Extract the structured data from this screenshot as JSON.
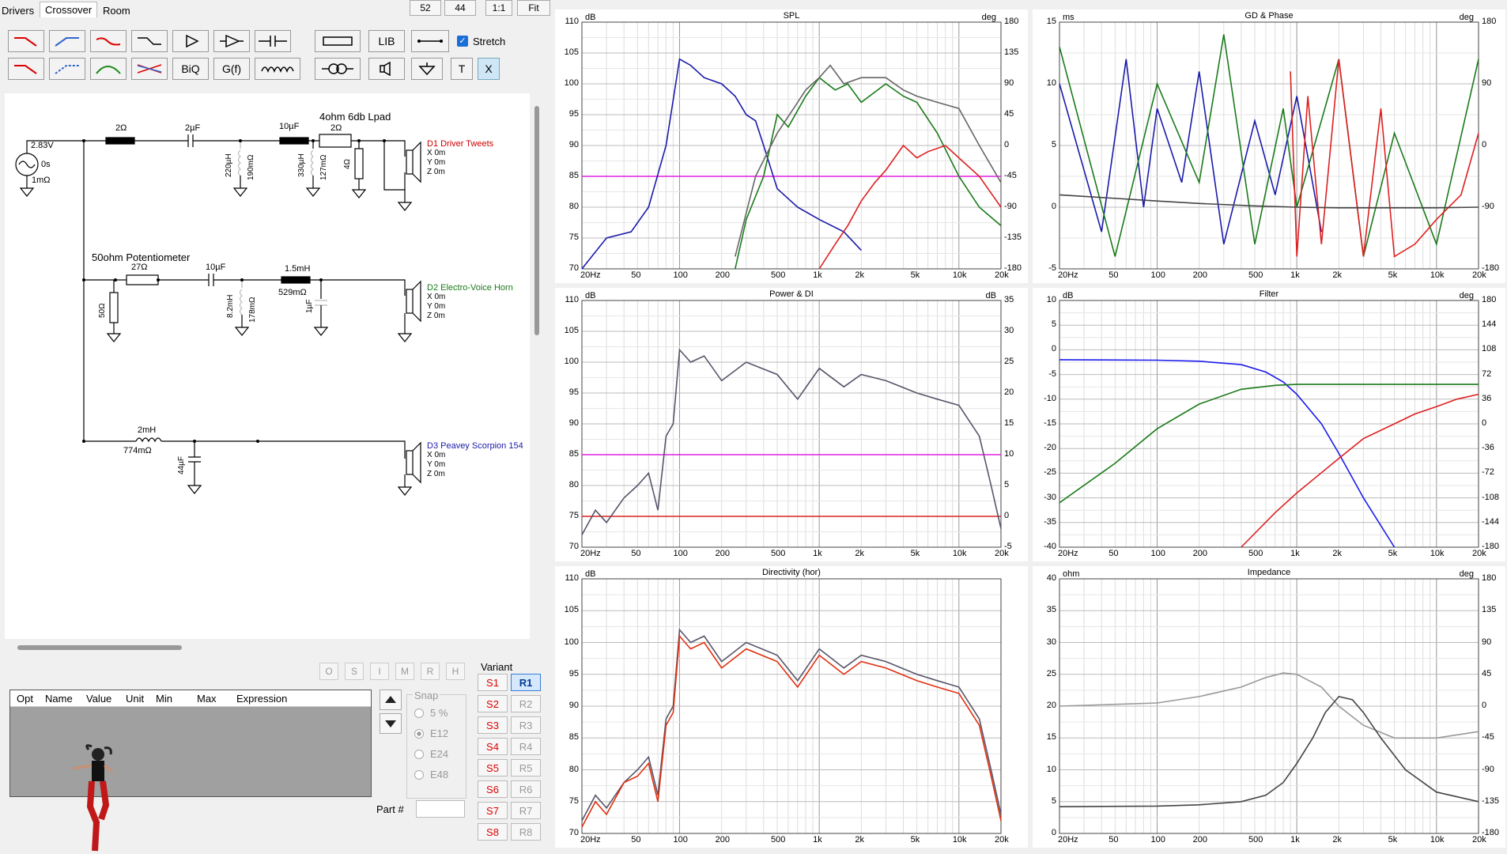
{
  "tabs": [
    {
      "label": "Drivers"
    },
    {
      "label": "Crossover"
    },
    {
      "label": "Room"
    }
  ],
  "top_buttons": [
    {
      "label": "52"
    },
    {
      "label": "44"
    },
    {
      "label": "1:1"
    },
    {
      "label": "Fit"
    }
  ],
  "toolbar": {
    "lib_label": "LIB",
    "biq_label": "BiQ",
    "gf_label": "G(f)",
    "t_label": "T",
    "x_label": "X",
    "stretch_label": "Stretch",
    "stretch_checked": true
  },
  "schematic": {
    "source": {
      "voltage": "2.83V",
      "delay": "0s",
      "resistance": "1mΩ"
    },
    "branch1": {
      "r1": "2Ω",
      "c1": "2µF",
      "l1": "220µH",
      "l1r": "190mΩ",
      "c2": "10µF",
      "l2": "330µH",
      "l2r": "127mΩ",
      "r2": "2Ω",
      "r3": "4Ω",
      "note": "4ohm 6db Lpad"
    },
    "branch2": {
      "note": "50ohm Potentiometer",
      "r1": "27Ω",
      "r2": "50Ω",
      "c1": "10µF",
      "l1": "8.2mH",
      "l1r": "178mΩ",
      "l2": "1.5mH",
      "l2r": "529mΩ",
      "c2": "1µF"
    },
    "branch3": {
      "l1": "2mH",
      "l1r": "774mΩ",
      "c1": "44µF"
    },
    "drivers": [
      {
        "name": "D1 Driver Tweets",
        "x": "X 0m",
        "y": "Y 0m",
        "z": "Z 0m",
        "color": "#cc0000"
      },
      {
        "name": "D2 Electro-Voice Horn",
        "x": "X 0m",
        "y": "Y 0m",
        "z": "Z 0m",
        "color": "#1a7a1a"
      },
      {
        "name": "D3 Peavey Scorpion 154",
        "x": "X 0m",
        "y": "Y 0m",
        "z": "Z 0m",
        "color": "#1a1aaa"
      }
    ]
  },
  "filter_buttons": [
    {
      "label": "O"
    },
    {
      "label": "S"
    },
    {
      "label": "I"
    },
    {
      "label": "M"
    },
    {
      "label": "R"
    },
    {
      "label": "H"
    }
  ],
  "param_table": {
    "columns": [
      "Opt",
      "Name",
      "Value",
      "Unit",
      "Min",
      "Max",
      "Expression"
    ]
  },
  "snap": {
    "label": "Snap",
    "options": [
      {
        "label": "5 %"
      },
      {
        "label": "E12"
      },
      {
        "label": "E24"
      },
      {
        "label": "E48"
      }
    ],
    "selected": 1
  },
  "part_label": "Part #",
  "variant": {
    "label": "Variant",
    "s": [
      {
        "label": "S1"
      },
      {
        "label": "S2"
      },
      {
        "label": "S3"
      },
      {
        "label": "S4"
      },
      {
        "label": "S5"
      },
      {
        "label": "S6"
      },
      {
        "label": "S7"
      },
      {
        "label": "S8"
      }
    ],
    "r": [
      {
        "label": "R1"
      },
      {
        "label": "R2"
      },
      {
        "label": "R3"
      },
      {
        "label": "R4"
      },
      {
        "label": "R5"
      },
      {
        "label": "R6"
      },
      {
        "label": "R7"
      },
      {
        "label": "R8"
      }
    ],
    "selected_r": "R1"
  },
  "freq_ticks": [
    "20Hz",
    "50",
    "100",
    "200",
    "500",
    "1k",
    "2k",
    "5k",
    "10k",
    "20k"
  ],
  "chart_data": [
    {
      "type": "line",
      "title": "SPL",
      "ylabel": "dB",
      "y2label": "deg",
      "yticks": [
        "110",
        "105",
        "100",
        "95",
        "90",
        "85",
        "80",
        "75",
        "70"
      ],
      "y2ticks": [
        "180",
        "135",
        "90",
        "45",
        "0",
        "-45",
        "-90",
        "-135",
        "-180"
      ],
      "xlim": [
        20,
        20000
      ],
      "ylim": [
        70,
        110
      ],
      "xscale": "log",
      "reference_line": {
        "y": 85,
        "color": "#e020e0"
      },
      "series": [
        {
          "color": "#1a1aaa",
          "x": [
            20,
            30,
            45,
            60,
            80,
            100,
            120,
            150,
            200,
            250,
            300,
            350,
            400,
            500,
            700,
            1000,
            1500,
            2000
          ],
          "y": [
            70,
            75,
            76,
            80,
            90,
            104,
            103,
            101,
            100,
            98,
            95,
            94,
            90,
            83,
            80,
            78,
            76,
            73
          ]
        },
        {
          "color": "#1a7a1a",
          "x": [
            250,
            300,
            400,
            500,
            600,
            800,
            1000,
            1300,
            1600,
            2000,
            3000,
            4000,
            5000,
            7000,
            10000,
            14000,
            20000
          ],
          "y": [
            70,
            78,
            85,
            95,
            93,
            98,
            101,
            99,
            100,
            97,
            100,
            98,
            97,
            92,
            85,
            80,
            77
          ]
        },
        {
          "color": "#dd2020",
          "x": [
            1000,
            1300,
            1600,
            2000,
            2500,
            3000,
            4000,
            5000,
            6000,
            8000,
            10000,
            14000,
            20000
          ],
          "y": [
            70,
            74,
            77,
            81,
            84,
            86,
            90,
            88,
            89,
            90,
            88,
            85,
            80
          ]
        },
        {
          "color": "#666666",
          "x": [
            250,
            350,
            500,
            700,
            800,
            1000,
            1200,
            1500,
            2000,
            3000,
            4000,
            5000,
            7000,
            10000,
            14000,
            20000
          ],
          "y": [
            72,
            85,
            92,
            97,
            99,
            101,
            103,
            100,
            101,
            101,
            99,
            98,
            97,
            96,
            90,
            84
          ]
        }
      ]
    },
    {
      "type": "line",
      "title": "GD & Phase",
      "ylabel": "ms",
      "y2label": "deg",
      "yticks": [
        "15",
        "10",
        "5",
        "0",
        "-5"
      ],
      "y2ticks": [
        "180",
        "90",
        "0",
        "-90",
        "-180"
      ],
      "xlim": [
        20,
        20000
      ],
      "ylim": [
        -5,
        15
      ],
      "xscale": "log",
      "series": [
        {
          "color": "#1a1aaa",
          "x": [
            20,
            40,
            60,
            80,
            100,
            150,
            200,
            300,
            500,
            700,
            1000,
            1500
          ],
          "y": [
            10,
            -2,
            12,
            0,
            8,
            2,
            11,
            -3,
            7,
            1,
            9,
            -2
          ]
        },
        {
          "color": "#1a7a1a",
          "x": [
            20,
            50,
            100,
            200,
            300,
            500,
            800,
            1000,
            2000,
            3000,
            5000,
            10000,
            20000
          ],
          "y": [
            13,
            -4,
            10,
            2,
            14,
            -3,
            8,
            0,
            12,
            -4,
            6,
            -3,
            12
          ]
        },
        {
          "color": "#dd2020",
          "x": [
            900,
            1000,
            1200,
            1500,
            2000,
            3000,
            4000,
            5000,
            7000,
            10000,
            15000,
            20000
          ],
          "y": [
            11,
            -4,
            9,
            -3,
            12,
            -4,
            8,
            -4,
            -3,
            -1,
            1,
            6
          ]
        },
        {
          "color": "#444444",
          "x": [
            20,
            100,
            200,
            500,
            1000,
            2000,
            5000,
            10000,
            20000
          ],
          "y": [
            1,
            0.5,
            0.3,
            0.1,
            0,
            -0.05,
            -0.05,
            -0.05,
            0
          ]
        }
      ]
    },
    {
      "type": "line",
      "title": "Power & DI",
      "ylabel": "dB",
      "y2label": "dB",
      "yticks": [
        "110",
        "105",
        "100",
        "95",
        "90",
        "85",
        "80",
        "75",
        "70"
      ],
      "y2ticks": [
        "35",
        "30",
        "25",
        "20",
        "15",
        "10",
        "5",
        "0",
        "-5"
      ],
      "xlim": [
        20,
        20000
      ],
      "ylim": [
        70,
        110
      ],
      "xscale": "log",
      "reference_lines": [
        {
          "y": 85,
          "color": "#e020e0"
        },
        {
          "y": 75,
          "color": "#dd2020"
        }
      ],
      "series": [
        {
          "color": "#55556a",
          "x": [
            20,
            25,
            30,
            40,
            50,
            60,
            70,
            80,
            90,
            100,
            120,
            150,
            200,
            300,
            500,
            700,
            1000,
            1500,
            2000,
            3000,
            5000,
            7000,
            10000,
            14000,
            17000,
            20000
          ],
          "y": [
            72,
            76,
            74,
            78,
            80,
            82,
            76,
            88,
            90,
            102,
            100,
            101,
            97,
            100,
            98,
            94,
            99,
            96,
            98,
            97,
            95,
            94,
            93,
            88,
            80,
            73
          ]
        }
      ]
    },
    {
      "type": "line",
      "title": "Filter",
      "ylabel": "dB",
      "y2label": "deg",
      "yticks": [
        "10",
        "5",
        "0",
        "-5",
        "-10",
        "-15",
        "-20",
        "-25",
        "-30",
        "-35",
        "-40"
      ],
      "y2ticks": [
        "180",
        "144",
        "108",
        "72",
        "36",
        "0",
        "-36",
        "-72",
        "-108",
        "-144",
        "-180"
      ],
      "xlim": [
        20,
        20000
      ],
      "ylim": [
        -40,
        10
      ],
      "xscale": "log",
      "series": [
        {
          "color": "#1a1aee",
          "x": [
            20,
            100,
            200,
            400,
            600,
            800,
            1000,
            1500,
            2000,
            3000,
            5000
          ],
          "y": [
            -2,
            -2.1,
            -2.3,
            -3,
            -4.5,
            -6.5,
            -9,
            -15,
            -21,
            -30,
            -40
          ]
        },
        {
          "color": "#1a7a1a",
          "x": [
            20,
            50,
            100,
            200,
            400,
            700,
            1000,
            2000,
            5000,
            10000,
            20000
          ],
          "y": [
            -31,
            -23,
            -16,
            -11,
            -8,
            -7.2,
            -7,
            -7,
            -7,
            -7,
            -7
          ]
        },
        {
          "color": "#dd2020",
          "x": [
            400,
            700,
            1000,
            2000,
            3000,
            5000,
            7000,
            10000,
            14000,
            20000
          ],
          "y": [
            -40,
            -33,
            -29,
            -22,
            -18,
            -15,
            -13,
            -11.5,
            -10,
            -9
          ]
        }
      ]
    },
    {
      "type": "line",
      "title": "Directivity (hor)",
      "ylabel": "dB",
      "yticks": [
        "110",
        "105",
        "100",
        "95",
        "90",
        "85",
        "80",
        "75",
        "70"
      ],
      "xlim": [
        20,
        20000
      ],
      "ylim": [
        70,
        110
      ],
      "xscale": "log",
      "series": [
        {
          "color": "#55556a",
          "x": [
            20,
            25,
            30,
            40,
            50,
            60,
            70,
            80,
            90,
            100,
            120,
            150,
            200,
            300,
            500,
            700,
            1000,
            1500,
            2000,
            3000,
            5000,
            7000,
            10000,
            14000,
            17000,
            20000
          ],
          "y": [
            72,
            76,
            74,
            78,
            80,
            82,
            76,
            88,
            90,
            102,
            100,
            101,
            97,
            100,
            98,
            94,
            99,
            96,
            98,
            97,
            95,
            94,
            93,
            88,
            80,
            73
          ]
        },
        {
          "color": "#e03010",
          "x": [
            20,
            25,
            30,
            40,
            50,
            60,
            70,
            80,
            90,
            100,
            120,
            150,
            200,
            300,
            500,
            700,
            1000,
            1500,
            2000,
            3000,
            5000,
            7000,
            10000,
            14000,
            17000,
            20000
          ],
          "y": [
            71,
            75,
            73,
            78,
            79,
            81,
            75,
            87,
            89,
            101,
            99,
            100,
            96,
            99,
            97,
            93,
            98,
            95,
            97,
            96,
            94,
            93,
            92,
            87,
            79,
            72
          ]
        }
      ]
    },
    {
      "type": "line",
      "title": "Impedance",
      "ylabel": "ohm",
      "y2label": "deg",
      "yticks": [
        "40",
        "35",
        "30",
        "25",
        "20",
        "15",
        "10",
        "5",
        "0"
      ],
      "y2ticks": [
        "180",
        "135",
        "90",
        "45",
        "0",
        "-45",
        "-90",
        "-135",
        "-180"
      ],
      "xlim": [
        20,
        20000
      ],
      "ylim": [
        0,
        40
      ],
      "xscale": "log",
      "series": [
        {
          "color": "#999999",
          "x": [
            20,
            100,
            200,
            400,
            600,
            800,
            1000,
            1500,
            2000,
            3000,
            5000,
            10000,
            20000
          ],
          "y": [
            20,
            20.5,
            21.5,
            23,
            24.5,
            25.2,
            25,
            23,
            20,
            17,
            15,
            15,
            16
          ]
        },
        {
          "color": "#444444",
          "x": [
            20,
            100,
            200,
            400,
            600,
            800,
            1000,
            1300,
            1600,
            2000,
            2500,
            3000,
            4000,
            6000,
            10000,
            20000
          ],
          "y": [
            4.2,
            4.3,
            4.5,
            5,
            6,
            8,
            11,
            15,
            19,
            21.5,
            21,
            19,
            15,
            10,
            6.5,
            5
          ]
        }
      ]
    }
  ]
}
